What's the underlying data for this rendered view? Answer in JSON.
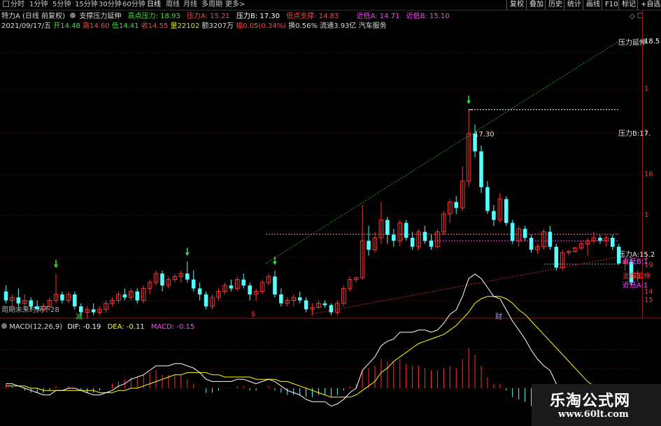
{
  "timeframes": [
    "分时",
    "1分钟",
    "5分钟",
    "15分钟",
    "30分钟",
    "60分钟",
    "日线",
    "周线",
    "月线",
    "多周期",
    "更多>"
  ],
  "active_timeframe": "日线",
  "right_buttons": [
    "复权",
    "叠加",
    "历史",
    "统计",
    "画线",
    "F10",
    "标记",
    "+自选"
  ],
  "header": {
    "stock": "特力A (日线 前复权)",
    "indicator": "支撑压力延伸",
    "high_pressure": "高点压力: 18.93",
    "pressure_a": "压力A: 15.21",
    "pressure_b": "压力B: 17.30",
    "low_support": "低点支撑: 14.83",
    "near_low_a": "近低A: 14.71",
    "near_low_b": "近低B: 15.10"
  },
  "quote": {
    "date": "2021/09/17/五",
    "open": "开14.48",
    "high": "高14.60",
    "low": "低14.41",
    "close": "收14.55",
    "volume": "量22102",
    "amount": "额3207万",
    "change": "幅0.05(0.34%)",
    "turnover": "换0.56%",
    "float": "流通3.93亿",
    "sector": "汽车服务"
  },
  "y_ticks": [
    "18.5",
    "1",
    "1",
    "16",
    "1",
    "1",
    "15",
    "19",
    "14"
  ],
  "chart_labels": {
    "pressure_ext": "压力延伸",
    "pressure_b": "压力B:17.",
    "pressure_a": "压力A:15.2",
    "near_low_b": "近低B:1",
    "support_ext": "支撑延伸",
    "near_low_a": "近低A:1",
    "peak_value": "17.30",
    "bottom_left": "周期未来时间不28",
    "marker_1": "减",
    "marker_2": "$",
    "marker_3": "财"
  },
  "macd": {
    "title": "MACD(12,26,9)",
    "dif": "DIF: -0.19",
    "dea": "DEA: -0.11",
    "macd": "MACD: -0.15"
  },
  "watermark": {
    "line1": "乐淘公式网",
    "line2": "www.60lt.com"
  },
  "colors": {
    "up": "#ff3232",
    "down": "#54ffff",
    "dif": "#ffffff",
    "dea": "#ffff00",
    "pressure_line": "#22a022",
    "support_line": "#c82828",
    "near_low": "#ff44ff"
  },
  "chart_data": {
    "type": "candlestick",
    "y_range_hint": [
      13.8,
      18.6
    ],
    "candles": [
      {
        "o": 14.25,
        "h": 14.35,
        "l": 14.05,
        "c": 14.1
      },
      {
        "o": 14.1,
        "h": 14.2,
        "l": 14.0,
        "c": 14.15
      },
      {
        "o": 14.15,
        "h": 14.3,
        "l": 14.0,
        "c": 14.05
      },
      {
        "o": 14.05,
        "h": 14.2,
        "l": 13.95,
        "c": 14.1
      },
      {
        "o": 14.1,
        "h": 14.15,
        "l": 13.95,
        "c": 14.0
      },
      {
        "o": 14.0,
        "h": 14.1,
        "l": 13.9,
        "c": 13.95
      },
      {
        "o": 13.95,
        "h": 14.05,
        "l": 13.9,
        "c": 14.0
      },
      {
        "o": 14.0,
        "h": 14.15,
        "l": 13.95,
        "c": 14.1
      },
      {
        "o": 14.1,
        "h": 14.55,
        "l": 14.05,
        "c": 14.2
      },
      {
        "o": 14.2,
        "h": 14.25,
        "l": 14.05,
        "c": 14.1
      },
      {
        "o": 14.1,
        "h": 14.25,
        "l": 14.05,
        "c": 14.2
      },
      {
        "o": 14.2,
        "h": 14.25,
        "l": 13.95,
        "c": 14.0
      },
      {
        "o": 14.0,
        "h": 14.05,
        "l": 13.85,
        "c": 13.9
      },
      {
        "o": 13.9,
        "h": 14.0,
        "l": 13.8,
        "c": 13.95
      },
      {
        "o": 13.95,
        "h": 14.05,
        "l": 13.85,
        "c": 13.9
      },
      {
        "o": 13.9,
        "h": 14.0,
        "l": 13.85,
        "c": 13.95
      },
      {
        "o": 13.95,
        "h": 14.1,
        "l": 13.9,
        "c": 14.05
      },
      {
        "o": 14.05,
        "h": 14.15,
        "l": 14.0,
        "c": 14.1
      },
      {
        "o": 14.1,
        "h": 14.25,
        "l": 14.05,
        "c": 14.2
      },
      {
        "o": 14.2,
        "h": 14.3,
        "l": 14.1,
        "c": 14.15
      },
      {
        "o": 14.15,
        "h": 14.3,
        "l": 14.1,
        "c": 14.25
      },
      {
        "o": 14.25,
        "h": 14.3,
        "l": 14.05,
        "c": 14.1
      },
      {
        "o": 14.1,
        "h": 14.35,
        "l": 14.05,
        "c": 14.3
      },
      {
        "o": 14.3,
        "h": 14.45,
        "l": 14.2,
        "c": 14.4
      },
      {
        "o": 14.4,
        "h": 14.6,
        "l": 14.35,
        "c": 14.55
      },
      {
        "o": 14.55,
        "h": 14.6,
        "l": 14.25,
        "c": 14.35
      },
      {
        "o": 14.35,
        "h": 14.5,
        "l": 14.3,
        "c": 14.45
      },
      {
        "o": 14.45,
        "h": 14.55,
        "l": 14.4,
        "c": 14.5
      },
      {
        "o": 14.5,
        "h": 14.6,
        "l": 14.4,
        "c": 14.55
      },
      {
        "o": 14.55,
        "h": 14.75,
        "l": 14.4,
        "c": 14.45
      },
      {
        "o": 14.45,
        "h": 14.6,
        "l": 14.25,
        "c": 14.3
      },
      {
        "o": 14.3,
        "h": 14.4,
        "l": 14.1,
        "c": 14.2
      },
      {
        "o": 14.2,
        "h": 14.25,
        "l": 13.95,
        "c": 14.0
      },
      {
        "o": 14.0,
        "h": 14.2,
        "l": 13.95,
        "c": 14.15
      },
      {
        "o": 14.15,
        "h": 14.3,
        "l": 14.1,
        "c": 14.25
      },
      {
        "o": 14.25,
        "h": 14.4,
        "l": 14.2,
        "c": 14.35
      },
      {
        "o": 14.35,
        "h": 14.45,
        "l": 14.25,
        "c": 14.3
      },
      {
        "o": 14.3,
        "h": 14.5,
        "l": 14.25,
        "c": 14.45
      },
      {
        "o": 14.45,
        "h": 14.55,
        "l": 14.3,
        "c": 14.35
      },
      {
        "o": 14.35,
        "h": 14.4,
        "l": 14.1,
        "c": 14.2
      },
      {
        "o": 14.2,
        "h": 14.3,
        "l": 14.1,
        "c": 14.25
      },
      {
        "o": 14.25,
        "h": 14.45,
        "l": 14.2,
        "c": 14.4
      },
      {
        "o": 14.4,
        "h": 14.55,
        "l": 14.35,
        "c": 14.5
      },
      {
        "o": 14.5,
        "h": 14.6,
        "l": 14.15,
        "c": 14.2
      },
      {
        "o": 14.2,
        "h": 14.3,
        "l": 14.0,
        "c": 14.05
      },
      {
        "o": 14.05,
        "h": 14.15,
        "l": 14.0,
        "c": 14.1
      },
      {
        "o": 14.1,
        "h": 14.2,
        "l": 14.0,
        "c": 14.15
      },
      {
        "o": 14.15,
        "h": 14.25,
        "l": 14.05,
        "c": 14.1
      },
      {
        "o": 14.1,
        "h": 14.15,
        "l": 13.9,
        "c": 13.95
      },
      {
        "o": 13.95,
        "h": 14.05,
        "l": 13.85,
        "c": 13.98
      },
      {
        "o": 13.98,
        "h": 14.1,
        "l": 13.95,
        "c": 14.05
      },
      {
        "o": 14.05,
        "h": 14.1,
        "l": 13.98,
        "c": 14.02
      },
      {
        "o": 14.02,
        "h": 14.05,
        "l": 13.85,
        "c": 13.9
      },
      {
        "o": 13.9,
        "h": 14.1,
        "l": 13.85,
        "c": 14.05
      },
      {
        "o": 14.05,
        "h": 14.35,
        "l": 14.0,
        "c": 14.3
      },
      {
        "o": 14.3,
        "h": 14.5,
        "l": 14.25,
        "c": 14.45
      },
      {
        "o": 14.45,
        "h": 14.5,
        "l": 14.4,
        "c": 14.48
      },
      {
        "o": 14.48,
        "h": 15.7,
        "l": 14.45,
        "c": 15.1
      },
      {
        "o": 15.1,
        "h": 15.35,
        "l": 14.85,
        "c": 14.95
      },
      {
        "o": 14.95,
        "h": 15.25,
        "l": 14.9,
        "c": 15.15
      },
      {
        "o": 15.15,
        "h": 15.75,
        "l": 15.05,
        "c": 15.45
      },
      {
        "o": 15.45,
        "h": 15.5,
        "l": 15.05,
        "c": 15.2
      },
      {
        "o": 15.2,
        "h": 15.3,
        "l": 15.0,
        "c": 15.1
      },
      {
        "o": 15.1,
        "h": 15.45,
        "l": 15.0,
        "c": 15.4
      },
      {
        "o": 15.4,
        "h": 15.45,
        "l": 15.1,
        "c": 15.15
      },
      {
        "o": 15.15,
        "h": 15.25,
        "l": 14.95,
        "c": 15.0
      },
      {
        "o": 15.0,
        "h": 15.3,
        "l": 14.95,
        "c": 15.25
      },
      {
        "o": 15.25,
        "h": 15.35,
        "l": 15.05,
        "c": 15.1
      },
      {
        "o": 15.1,
        "h": 15.2,
        "l": 14.95,
        "c": 15.0
      },
      {
        "o": 15.0,
        "h": 15.3,
        "l": 14.98,
        "c": 15.25
      },
      {
        "o": 15.25,
        "h": 15.6,
        "l": 15.2,
        "c": 15.55
      },
      {
        "o": 15.55,
        "h": 15.8,
        "l": 15.4,
        "c": 15.75
      },
      {
        "o": 15.75,
        "h": 15.85,
        "l": 15.55,
        "c": 15.65
      },
      {
        "o": 15.65,
        "h": 16.35,
        "l": 15.6,
        "c": 16.1
      },
      {
        "o": 16.1,
        "h": 17.3,
        "l": 16.0,
        "c": 16.9
      },
      {
        "o": 16.9,
        "h": 17.05,
        "l": 16.5,
        "c": 16.6
      },
      {
        "o": 16.6,
        "h": 16.7,
        "l": 15.9,
        "c": 16.0
      },
      {
        "o": 16.0,
        "h": 16.1,
        "l": 15.55,
        "c": 15.6
      },
      {
        "o": 15.6,
        "h": 15.7,
        "l": 15.35,
        "c": 15.45
      },
      {
        "o": 15.45,
        "h": 15.9,
        "l": 15.4,
        "c": 15.8
      },
      {
        "o": 15.8,
        "h": 15.85,
        "l": 15.35,
        "c": 15.4
      },
      {
        "o": 15.4,
        "h": 15.45,
        "l": 15.05,
        "c": 15.1
      },
      {
        "o": 15.1,
        "h": 15.35,
        "l": 15.0,
        "c": 15.3
      },
      {
        "o": 15.3,
        "h": 15.35,
        "l": 15.1,
        "c": 15.15
      },
      {
        "o": 15.15,
        "h": 15.2,
        "l": 14.9,
        "c": 14.95
      },
      {
        "o": 14.95,
        "h": 15.05,
        "l": 14.88,
        "c": 15.0
      },
      {
        "o": 15.0,
        "h": 15.3,
        "l": 14.95,
        "c": 15.25
      },
      {
        "o": 15.25,
        "h": 15.35,
        "l": 14.95,
        "c": 15.0
      },
      {
        "o": 15.0,
        "h": 15.05,
        "l": 14.6,
        "c": 14.65
      },
      {
        "o": 14.65,
        "h": 14.95,
        "l": 14.6,
        "c": 14.9
      },
      {
        "o": 14.9,
        "h": 14.95,
        "l": 14.85,
        "c": 14.92
      },
      {
        "o": 14.92,
        "h": 15.0,
        "l": 14.9,
        "c": 14.98
      },
      {
        "o": 14.98,
        "h": 15.1,
        "l": 14.95,
        "c": 15.05
      },
      {
        "o": 15.05,
        "h": 15.15,
        "l": 14.85,
        "c": 15.1
      },
      {
        "o": 15.1,
        "h": 15.25,
        "l": 15.05,
        "c": 15.15
      },
      {
        "o": 15.15,
        "h": 15.2,
        "l": 15.05,
        "c": 15.1
      },
      {
        "o": 15.1,
        "h": 15.2,
        "l": 15.0,
        "c": 15.15
      },
      {
        "o": 15.15,
        "h": 15.2,
        "l": 14.95,
        "c": 15.0
      },
      {
        "o": 15.0,
        "h": 15.05,
        "l": 14.7,
        "c": 14.72
      },
      {
        "o": 14.72,
        "h": 14.8,
        "l": 14.6,
        "c": 14.75
      },
      {
        "o": 14.75,
        "h": 14.8,
        "l": 14.35,
        "c": 14.4
      },
      {
        "o": 14.48,
        "h": 14.6,
        "l": 14.41,
        "c": 14.55
      }
    ],
    "macd_hist": [
      0.02,
      0.01,
      0.0,
      -0.01,
      -0.02,
      -0.02,
      -0.02,
      -0.01,
      0.01,
      0.0,
      0.01,
      0.0,
      -0.01,
      -0.02,
      -0.02,
      -0.01,
      0.0,
      0.02,
      0.03,
      0.04,
      0.05,
      0.05,
      0.06,
      0.07,
      0.08,
      0.06,
      0.06,
      0.06,
      0.06,
      0.04,
      0.02,
      0.0,
      -0.02,
      -0.02,
      -0.01,
      0.0,
      0.0,
      0.01,
      0.01,
      -0.01,
      -0.01,
      0.0,
      0.01,
      -0.01,
      -0.02,
      -0.03,
      -0.03,
      -0.03,
      -0.04,
      -0.04,
      -0.03,
      -0.03,
      -0.04,
      -0.03,
      -0.01,
      0.01,
      0.02,
      0.08,
      0.09,
      0.1,
      0.13,
      0.12,
      0.12,
      0.13,
      0.11,
      0.1,
      0.1,
      0.09,
      0.08,
      0.08,
      0.09,
      0.1,
      0.09,
      0.13,
      0.18,
      0.15,
      0.1,
      0.05,
      0.02,
      0.02,
      -0.01,
      -0.04,
      -0.05,
      -0.06,
      -0.08,
      -0.08,
      -0.07,
      -0.07,
      -0.1,
      -0.1,
      -0.1,
      -0.11,
      -0.12,
      -0.12,
      -0.12,
      -0.12,
      -0.13,
      -0.15,
      -0.16,
      -0.18,
      -0.17,
      -0.15
    ],
    "dif": [
      0.02,
      0.02,
      0.01,
      0.0,
      -0.01,
      -0.02,
      -0.03,
      -0.03,
      -0.01,
      -0.01,
      0.0,
      0.0,
      -0.01,
      -0.02,
      -0.03,
      -0.03,
      -0.02,
      -0.01,
      0.01,
      0.02,
      0.04,
      0.05,
      0.06,
      0.08,
      0.1,
      0.1,
      0.1,
      0.11,
      0.11,
      0.1,
      0.09,
      0.07,
      0.04,
      0.03,
      0.03,
      0.03,
      0.03,
      0.04,
      0.04,
      0.03,
      0.02,
      0.03,
      0.04,
      0.03,
      0.01,
      -0.01,
      -0.02,
      -0.03,
      -0.05,
      -0.06,
      -0.06,
      -0.06,
      -0.08,
      -0.07,
      -0.05,
      -0.02,
      0.0,
      0.08,
      0.11,
      0.14,
      0.19,
      0.21,
      0.22,
      0.25,
      0.25,
      0.25,
      0.26,
      0.26,
      0.25,
      0.26,
      0.29,
      0.33,
      0.35,
      0.41,
      0.49,
      0.51,
      0.49,
      0.45,
      0.41,
      0.4,
      0.35,
      0.3,
      0.26,
      0.22,
      0.17,
      0.13,
      0.1,
      0.08,
      0.02,
      -0.01,
      -0.04,
      -0.06,
      -0.08,
      -0.09,
      -0.1,
      -0.11,
      -0.12,
      -0.14,
      -0.16,
      -0.2,
      -0.22,
      -0.19
    ],
    "dea": [
      0.01,
      0.01,
      0.01,
      0.01,
      0.0,
      0.0,
      -0.01,
      -0.01,
      -0.01,
      -0.01,
      -0.01,
      -0.01,
      -0.01,
      -0.01,
      -0.01,
      -0.02,
      -0.02,
      -0.02,
      -0.01,
      -0.01,
      0.0,
      0.0,
      0.01,
      0.02,
      0.03,
      0.04,
      0.05,
      0.06,
      0.06,
      0.07,
      0.07,
      0.07,
      0.07,
      0.06,
      0.06,
      0.05,
      0.05,
      0.05,
      0.05,
      0.05,
      0.04,
      0.04,
      0.04,
      0.04,
      0.03,
      0.03,
      0.02,
      0.01,
      0.0,
      -0.01,
      -0.02,
      -0.03,
      -0.04,
      -0.04,
      -0.04,
      -0.04,
      -0.03,
      -0.01,
      0.01,
      0.03,
      0.07,
      0.09,
      0.12,
      0.14,
      0.16,
      0.18,
      0.2,
      0.21,
      0.22,
      0.23,
      0.24,
      0.26,
      0.28,
      0.31,
      0.34,
      0.38,
      0.4,
      0.41,
      0.41,
      0.41,
      0.4,
      0.38,
      0.35,
      0.33,
      0.3,
      0.27,
      0.24,
      0.21,
      0.18,
      0.15,
      0.12,
      0.09,
      0.06,
      0.03,
      0.01,
      -0.01,
      -0.03,
      -0.05,
      -0.07,
      -0.09,
      -0.1,
      -0.11
    ]
  }
}
